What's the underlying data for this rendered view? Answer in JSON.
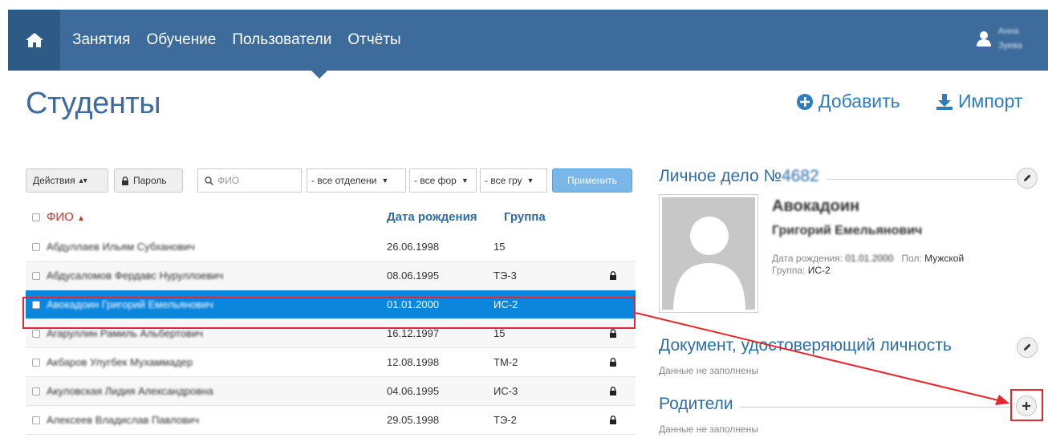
{
  "nav": {
    "items": [
      "Занятия",
      "Обучение",
      "Пользователи",
      "Отчёты"
    ],
    "user_name_line1": "Анна",
    "user_name_line2": "Зуева"
  },
  "header": {
    "title": "Студенты",
    "add_label": "Добавить",
    "import_label": "Импорт"
  },
  "toolbar": {
    "actions_label": "Действия",
    "password_label": "Пароль",
    "search_placeholder": "ФИО",
    "filter_department": "- все отделени",
    "filter_form": "- все фор",
    "filter_group": "- все гру",
    "apply_label": "Применить"
  },
  "table": {
    "col_fio": "ФИО",
    "col_dob": "Дата рождения",
    "col_group": "Группа",
    "rows": [
      {
        "name": "Абдуллаев Ильям Субханович",
        "dob": "26.06.1998",
        "group": "15",
        "locked": false
      },
      {
        "name": "Абдусаломов Фердавс Нуруллоевич",
        "dob": "08.06.1995",
        "group": "ТЭ-3",
        "locked": true
      },
      {
        "name": "Авокадоин Григорий Емельянович",
        "dob": "01.01.2000",
        "group": "ИС-2",
        "locked": false
      },
      {
        "name": "Агаруллин Рамиль Альбертович",
        "dob": "16.12.1997",
        "group": "15",
        "locked": true
      },
      {
        "name": "Акбаров Улугбек Мухаммадер",
        "dob": "12.08.1998",
        "group": "ТМ-2",
        "locked": true
      },
      {
        "name": "Акуловская Лидия Александровна",
        "dob": "04.06.1995",
        "group": "ИС-3",
        "locked": true
      },
      {
        "name": "Алексеев Владислав Павлович",
        "dob": "29.05.1998",
        "group": "ТЭ-2",
        "locked": true
      }
    ]
  },
  "profile": {
    "section_title": "Личное дело №",
    "record_number": "4682",
    "last_name": "Авокадоин",
    "first_middle": "Григорий Емельянович",
    "dob_label": "Дата рождения:",
    "dob_value": "01.01.2000",
    "sex_label": "Пол:",
    "sex_value": "Мужской",
    "group_label": "Группа:",
    "group_value": "ИС-2",
    "no_photo": "НЕТ ФОТО"
  },
  "document": {
    "title": "Документ, удостоверяющий личность",
    "empty": "Данные не заполнены"
  },
  "parents": {
    "title": "Родители",
    "empty": "Данные не заполнены"
  },
  "colors": {
    "nav_bg": "#3d6b9b",
    "accent": "#2e7bbd",
    "selected_row": "#0a86dd",
    "annotation": "#e8262e"
  }
}
